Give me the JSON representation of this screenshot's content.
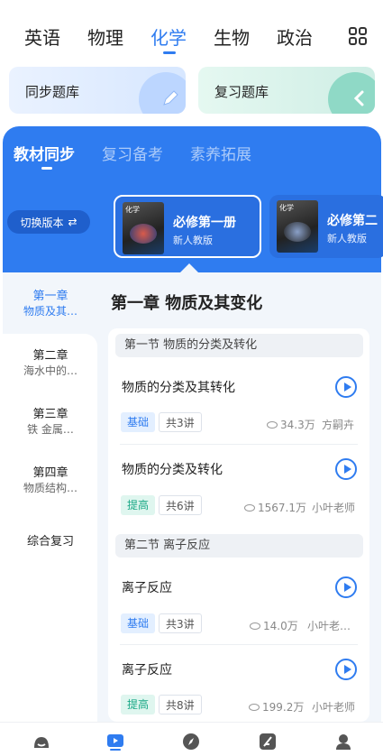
{
  "subjects": [
    {
      "label": "英语",
      "active": false
    },
    {
      "label": "物理",
      "active": false
    },
    {
      "label": "化学",
      "active": true
    },
    {
      "label": "生物",
      "active": false
    },
    {
      "label": "政治",
      "active": false
    }
  ],
  "quick_cards": {
    "sync": "同步题库",
    "review": "复习题库"
  },
  "segments": [
    "教材同步",
    "复习备考",
    "素养拓展"
  ],
  "switch_version": "切换版本",
  "books": [
    {
      "cover_text": "化学",
      "title": "必修第一册",
      "subtitle": "新人教版"
    },
    {
      "cover_text": "化学",
      "title": "必修第二",
      "subtitle": "新人教版"
    }
  ],
  "chapters": [
    {
      "line1": "第一章",
      "line2": "物质及其…",
      "active": true
    },
    {
      "line1": "第二章",
      "line2": "海水中的…",
      "active": false
    },
    {
      "line1": "第三章",
      "line2": "铁 金属…",
      "active": false
    },
    {
      "line1": "第四章",
      "line2": "物质结构…",
      "active": false
    },
    {
      "line1": "综合复习",
      "line2": "",
      "active": false
    }
  ],
  "chapter_title": "第一章  物质及其变化",
  "sections": [
    {
      "title": "第一节 物质的分类及转化",
      "items": [
        {
          "title": "物质的分类及其转化",
          "level": "基础",
          "lectures": "共3讲",
          "views": "34.3万",
          "author": "方嗣卉"
        },
        {
          "title": "物质的分类及转化",
          "level": "提高",
          "lectures": "共6讲",
          "views": "1567.1万",
          "author": "小叶老师"
        }
      ]
    },
    {
      "title": "第二节 离子反应",
      "items": [
        {
          "title": "离子反应",
          "level": "基础",
          "lectures": "共3讲",
          "views": "14.0万",
          "author": "小叶老…"
        },
        {
          "title": "离子反应",
          "level": "提高",
          "lectures": "共8讲",
          "views": "199.2万",
          "author": "小叶老师"
        }
      ]
    }
  ],
  "bottom_nav": [
    {
      "icon": "home-icon",
      "active": false
    },
    {
      "icon": "video-play-icon",
      "active": true
    },
    {
      "icon": "compass-icon",
      "active": false
    },
    {
      "icon": "feather-icon",
      "active": false
    },
    {
      "icon": "profile-icon",
      "active": false
    }
  ],
  "colors": {
    "accent": "#2f7cf0",
    "teal": "#19a886",
    "panel_bg": "#f2f6fb"
  }
}
